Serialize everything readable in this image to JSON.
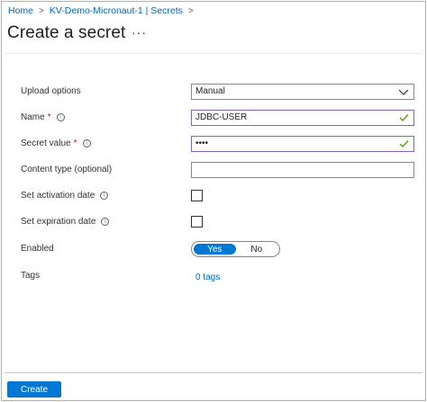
{
  "breadcrumb": {
    "home": "Home",
    "vault": "KV-Demo-Micronaut-1 | Secrets",
    "separator": ">"
  },
  "page": {
    "title": "Create a secret",
    "more": "···"
  },
  "form": {
    "upload_options": {
      "label": "Upload options",
      "value": "Manual"
    },
    "name": {
      "label": "Name",
      "required_mark": "*",
      "value": "JDBC-USER"
    },
    "secret_value": {
      "label": "Secret value",
      "required_mark": "*",
      "value": "••••"
    },
    "content_type": {
      "label": "Content type (optional)",
      "value": ""
    },
    "activation": {
      "label": "Set activation date"
    },
    "expiration": {
      "label": "Set expiration date"
    },
    "enabled": {
      "label": "Enabled",
      "yes": "Yes",
      "no": "No"
    },
    "tags": {
      "label": "Tags",
      "link": "0 tags"
    }
  },
  "footer": {
    "create_label": "Create"
  },
  "colors": {
    "accent": "#0078d4",
    "link": "#0067b8",
    "valid_border": "#8764b8",
    "valid_check": "#57a300"
  }
}
